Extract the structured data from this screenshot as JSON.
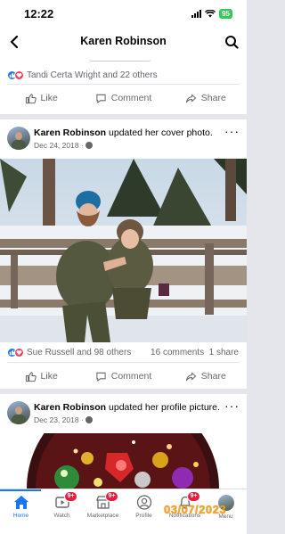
{
  "status_bar": {
    "time": "12:22",
    "battery": "95"
  },
  "header": {
    "title": "Karen Robinson"
  },
  "top_post": {
    "reactions_text": "Tandi Certa Wright and 22 others",
    "actions": {
      "like": "Like",
      "comment": "Comment",
      "share": "Share"
    }
  },
  "post1": {
    "author": "Karen Robinson",
    "action_text": " updated her cover photo.",
    "date": "Dec 24, 2018 ·",
    "reactions_text": "Sue Russell and 98 others",
    "comments": "16 comments",
    "shares": "1 share",
    "actions": {
      "like": "Like",
      "comment": "Comment",
      "share": "Share"
    }
  },
  "post2": {
    "author": "Karen Robinson",
    "action_text": " updated her profile picture.",
    "date": "Dec 23, 2018 ·"
  },
  "tab_bar": {
    "home": "Home",
    "watch": "Watch",
    "watch_badge": "9+",
    "marketplace": "Marketplace",
    "marketplace_badge": "9+",
    "profile": "Profile",
    "notifications": "Notifications",
    "notifications_badge": "9+",
    "menu": "Menu"
  },
  "date_stamp": "03/07/2023",
  "colors": {
    "accent": "#1877f2",
    "badge": "#e41e3f",
    "love": "#f33e58"
  }
}
